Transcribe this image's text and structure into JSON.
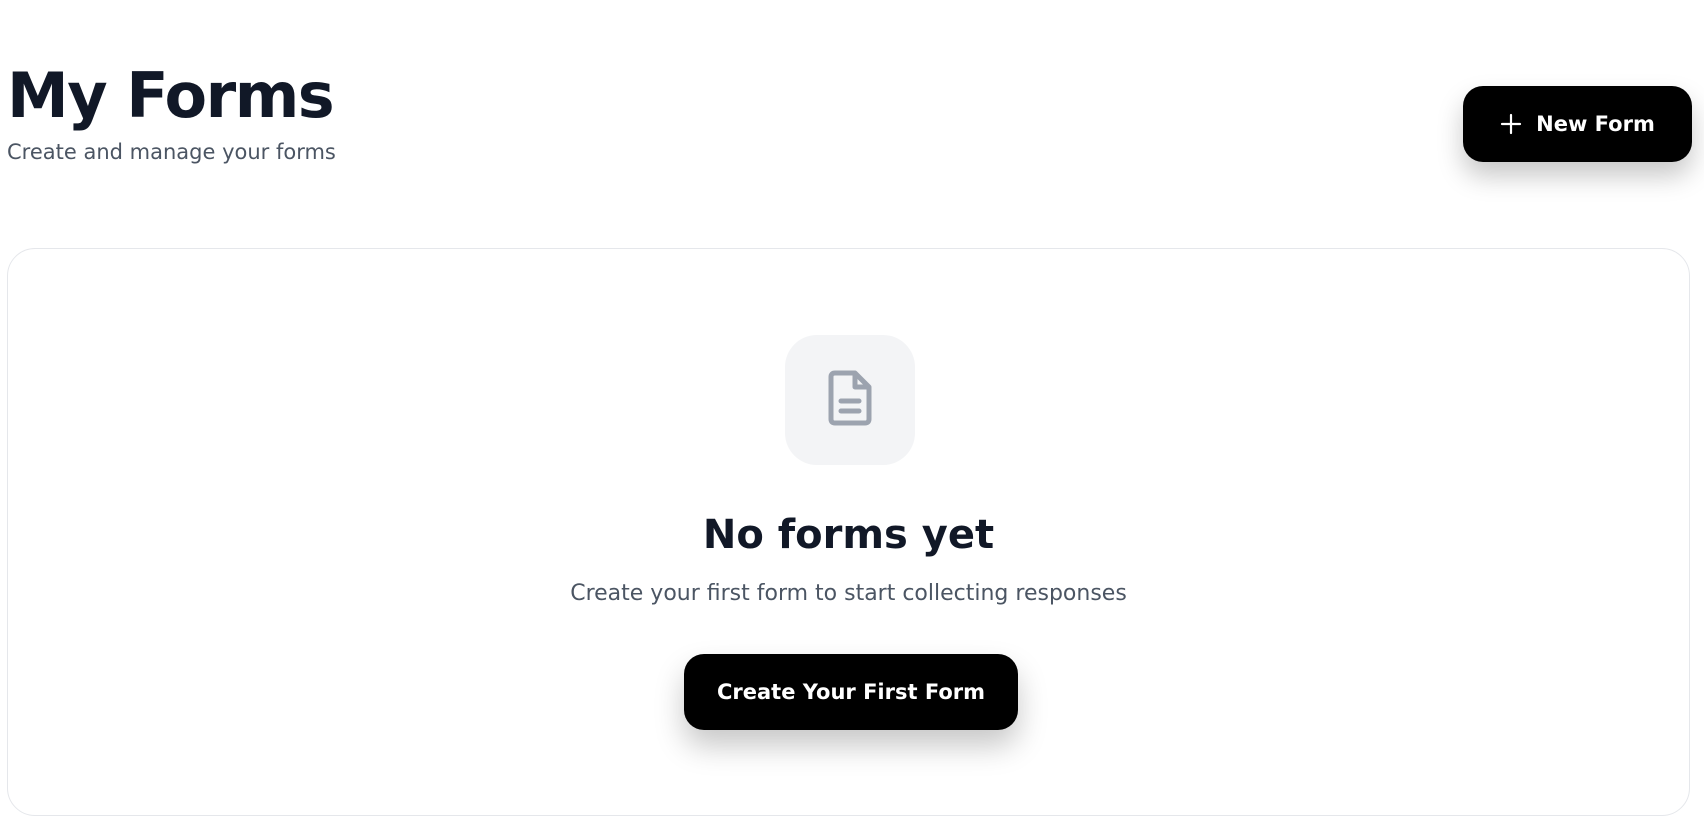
{
  "header": {
    "title": "My Forms",
    "subtitle": "Create and manage your forms"
  },
  "toolbar": {
    "new_form_label": "New Form",
    "new_form_icon": "plus-icon"
  },
  "empty_state": {
    "icon": "document-icon",
    "title": "No forms yet",
    "subtitle": "Create your first form to start collecting responses",
    "cta_label": "Create Your First Form"
  },
  "colors": {
    "primary_button": "#000000",
    "title_text": "#111827",
    "muted_text": "#4b5563",
    "icon_box_bg": "#f3f4f6",
    "icon_stroke": "#9ca3af",
    "card_border": "#e5e7eb"
  }
}
